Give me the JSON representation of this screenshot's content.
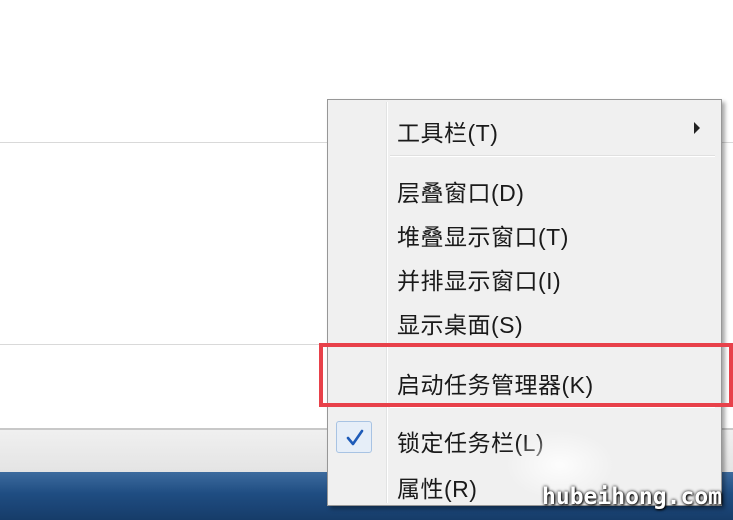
{
  "context_menu": {
    "items": [
      {
        "label": "工具栏(T)",
        "has_submenu": true
      },
      {
        "label": "层叠窗口(D)"
      },
      {
        "label": "堆叠显示窗口(T)"
      },
      {
        "label": "并排显示窗口(I)"
      },
      {
        "label": "显示桌面(S)"
      },
      {
        "label": "启动任务管理器(K)",
        "highlighted": true
      },
      {
        "label": "锁定任务栏(L)",
        "checked": true
      },
      {
        "label": "属性(R)"
      }
    ]
  },
  "watermark": "hubeihong.com",
  "colors": {
    "highlight_border": "#e8414a",
    "menu_background": "#f0f0f0",
    "taskbar": "#1f4d82",
    "checkmark": "#1e5bb8"
  },
  "icons": {
    "submenu": "chevron-right-icon",
    "check": "checkmark-icon"
  }
}
